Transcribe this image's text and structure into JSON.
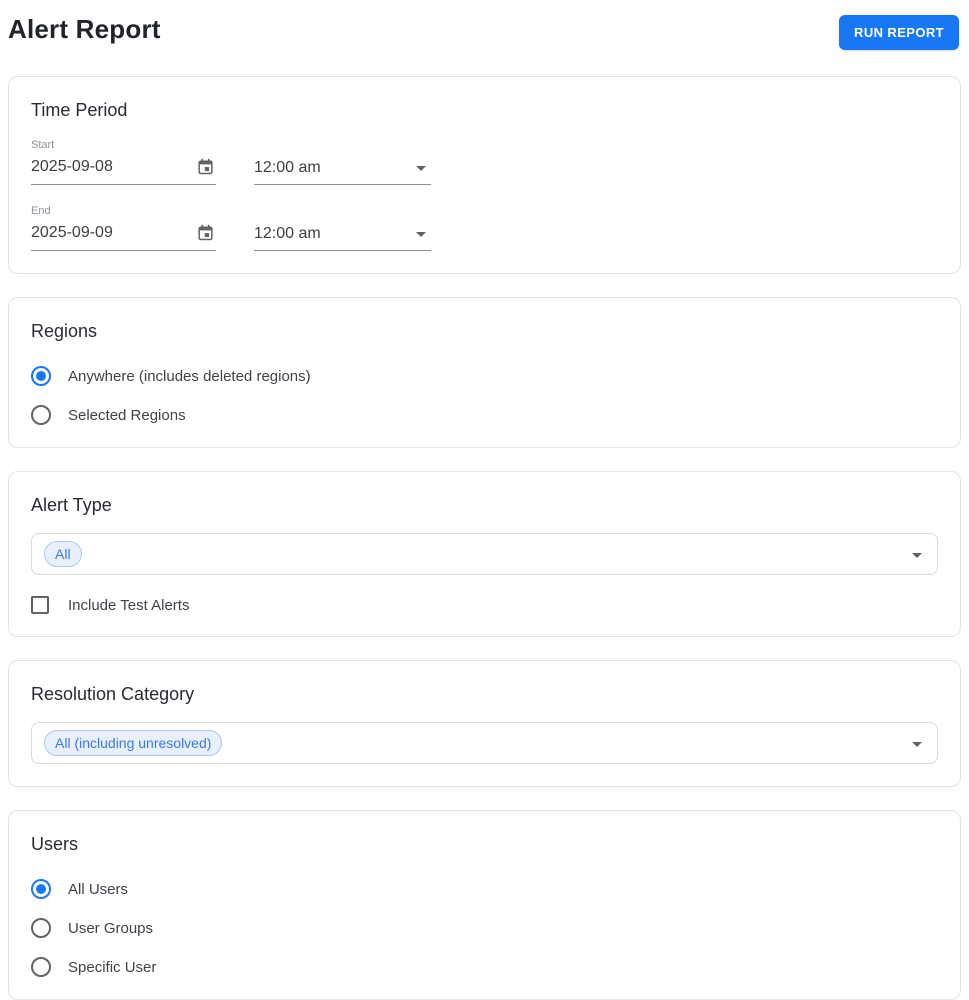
{
  "colors": {
    "accent": "#1877f2",
    "chip-text": "#3b78e7",
    "chip-bg": "#e9f0fd",
    "chip-border": "#a9c7f5"
  },
  "page": {
    "title": "Alert Report"
  },
  "toolbar": {
    "run_report_label": "RUN REPORT"
  },
  "time_period": {
    "title": "Time Period",
    "start": {
      "label": "Start",
      "date": "2025-09-08",
      "time": "12:00 am"
    },
    "end": {
      "label": "End",
      "date": "2025-09-09",
      "time": "12:00 am"
    }
  },
  "regions": {
    "title": "Regions",
    "options": [
      {
        "label": "Anywhere (includes deleted regions)",
        "selected": true
      },
      {
        "label": "Selected Regions",
        "selected": false
      }
    ]
  },
  "alert_type": {
    "title": "Alert Type",
    "selected_chip": "All",
    "checkbox_label": "Include Test Alerts",
    "checkbox_checked": false
  },
  "resolution_category": {
    "title": "Resolution Category",
    "selected_chip": "All (including unresolved)"
  },
  "users": {
    "title": "Users",
    "options": [
      {
        "label": "All Users",
        "selected": true
      },
      {
        "label": "User Groups",
        "selected": false
      },
      {
        "label": "Specific User",
        "selected": false
      }
    ]
  }
}
